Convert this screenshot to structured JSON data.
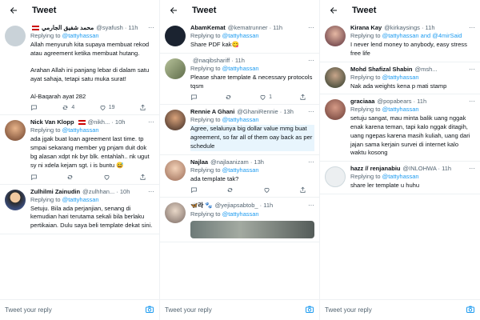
{
  "common": {
    "title": "Tweet",
    "reply_placeholder": "Tweet your reply",
    "replying_prefix": "Replying to ",
    "reply_target": "@tattyhassan"
  },
  "colors": {
    "accent": "#1d9bf0",
    "muted": "#536471",
    "text": "#0f1419"
  },
  "panels": [
    {
      "tweets": [
        {
          "name": "محمد شفيق الجارمي",
          "handle": "@syafush · 11h",
          "flag": "malaysia-flag",
          "reply_to": "@tattyhassan",
          "text": "Allah menyuruh kita supaya membuat rekod atau agreement ketika membuat hutang.\n\nArahan Allah ini panjang lebar di dalam satu ayat sahaja, tetapi satu muka surat!\n\nAl-Baqarah ayat 282",
          "retweets": "4",
          "likes": "19"
        },
        {
          "name": "Nick Van Klopp",
          "handle": "@nikh... · 10h",
          "flag": "malaysia-flag",
          "reply_to": "@tattyhassan",
          "text": "ada jgak buat loan agreement last time. tp smpai sekarang member yg pnjam duit dok bg alasan xdpt nk byr blk. entahlah.. nk ugut sy ni xdela kejam sgt. i is buntu 😅",
          "retweets": "",
          "likes": ""
        },
        {
          "name": "Zulhilmi Zainudin",
          "handle": "@zulhhan... · 10h",
          "flag": "",
          "reply_to": "@tattyhassan",
          "text": "Setuju. Bila ada perjanjian, senang di kemudian hari terutama sekali bila berlaku pertikaian. Dulu saya beli template dekat sini.",
          "retweets": "",
          "likes": ""
        }
      ]
    },
    {
      "tweets": [
        {
          "name": "AbamKemat",
          "handle": "@kematrunner · 11h",
          "reply_to": "@tattyhassan",
          "text": "Share PDF kak😋",
          "retweets": "",
          "likes": ""
        },
        {
          "name": "",
          "handle": "@naqibshariff · 11h",
          "reply_to": "@tattyhassan",
          "text": "Please share template & necessary protocols tqsm",
          "retweets": "",
          "likes": "1"
        },
        {
          "name": "Rennie A Ghani",
          "handle": "@GhaniRennie · 13h",
          "reply_to": "@tattyhassan",
          "text": "Agree, selalunya big dollar value mmg buat agreement, so far all of them oay back as per schedule",
          "retweets": "",
          "likes": ""
        },
        {
          "name": "Najlaa",
          "handle": "@najlaanizam · 13h",
          "reply_to": "@tattyhassan",
          "text": "ada template tak?",
          "retweets": "",
          "likes": ""
        },
        {
          "name": "🦋라 🐾",
          "handle": "@yejiapsabtob_ · 11h",
          "reply_to": "@tattyhassan",
          "text": "",
          "retweets": "",
          "likes": ""
        }
      ]
    },
    {
      "tweets": [
        {
          "name": "Kirana Kay",
          "handle": "@kirkaysings · 11h",
          "reply_to": "@tattyhassan and @4mirSaid",
          "text": "I never lend money to anybody, easy stress free life",
          "retweets": "",
          "likes": ""
        },
        {
          "name": "Mohd Shafizal Shabin",
          "handle": "@msh...",
          "reply_to": "@tattyhassan",
          "text": "Nak ada weights kena p mati stamp",
          "retweets": "",
          "likes": ""
        },
        {
          "name": "graciaaa",
          "handle": "@popabears · 11h",
          "reply_to": "@tattyhassan",
          "text": "setuju sangat, mau minta balik uang nggak enak karena teman, tapi kalo nggak ditagih, uang ngepas karena masih kuliah, uang dari jajan sama kerjain survei di internet kalo waktu kosong",
          "retweets": "",
          "likes": ""
        },
        {
          "name": "hazz // renjanabiu",
          "handle": "@INLOHWA · 11h",
          "reply_to": "@tattyhassan",
          "text": "share ler template u huhu",
          "retweets": "",
          "likes": ""
        }
      ]
    }
  ]
}
